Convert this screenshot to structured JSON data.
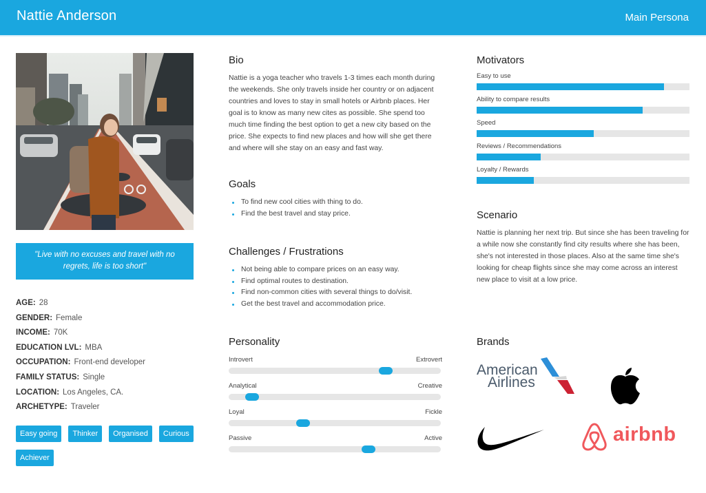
{
  "header": {
    "name": "Nattie Anderson",
    "persona_type": "Main Persona"
  },
  "profile": {
    "photo_alt": "Woman with backpack standing on a city bike lane",
    "quote": "\"Live with no excuses and travel with no regrets, life is too short\"",
    "facts": [
      {
        "key": "AGE:",
        "value": "28"
      },
      {
        "key": "GENDER:",
        "value": "Female"
      },
      {
        "key": "INCOME:",
        "value": "70K"
      },
      {
        "key": "EDUCATION LVL:",
        "value": "MBA"
      },
      {
        "key": "OCCUPATION:",
        "value": "Front-end developer"
      },
      {
        "key": "FAMILY STATUS:",
        "value": "Single"
      },
      {
        "key": "LOCATION:",
        "value": "Los Angeles, CA."
      },
      {
        "key": "ARCHETYPE:",
        "value": "Traveler"
      }
    ],
    "tags": [
      "Easy going",
      "Thinker",
      "Organised",
      "Curious",
      "Achiever"
    ]
  },
  "bio": {
    "title": "Bio",
    "text": "Nattie is a yoga teacher who travels 1-3 times each month during the weekends. She only travels inside her country or on adjacent countries and loves to stay in small hotels or Airbnb places. Her goal is to know as many new cites as possible. She spend too much time finding the best option to get a new city based on the price. She expects to find new places and how will she get there and where will she stay on an easy and fast way."
  },
  "goals": {
    "title": "Goals",
    "items": [
      "To find new cool cities with thing to do.",
      "Find the best travel and stay price."
    ]
  },
  "challenges": {
    "title": "Challenges / Frustrations",
    "items": [
      "Not being able to compare prices on an easy way.",
      "Find optimal routes to destination.",
      "Find non-common cities with several things to do/visit.",
      "Get the best travel and accommodation price."
    ]
  },
  "personality": {
    "title": "Personality",
    "traits": [
      {
        "left": "Introvert",
        "right": "Extrovert",
        "value": 0.74
      },
      {
        "left": "Analytical",
        "right": "Creative",
        "value": 0.11
      },
      {
        "left": "Loyal",
        "right": "Fickle",
        "value": 0.35
      },
      {
        "left": "Passive",
        "right": "Active",
        "value": 0.66
      }
    ]
  },
  "motivators": {
    "title": "Motivators",
    "items": [
      {
        "label": "Easy to use",
        "value": 0.88
      },
      {
        "label": "Ability to compare results",
        "value": 0.78
      },
      {
        "label": "Speed",
        "value": 0.55
      },
      {
        "label": "Reviews / Recommendations",
        "value": 0.3
      },
      {
        "label": "Loyalty / Rewards",
        "value": 0.27
      }
    ]
  },
  "scenario": {
    "title": "Scenario",
    "text": "Nattie is planning her next trip. But since she has been traveling for a while now she constantly find city results where she has been, she's not interested in those places. Also at the same time she's looking for cheap flights since she may come across an interest new place to visit at a low price."
  },
  "brands": {
    "title": "Brands",
    "items": [
      {
        "name": "American Airlines",
        "line1": "American",
        "line2": "Airlines",
        "icon": "american-airlines-logo"
      },
      {
        "name": "Apple",
        "icon": "apple-logo"
      },
      {
        "name": "Nike",
        "icon": "nike-swoosh-logo"
      },
      {
        "name": "Airbnb",
        "wordmark": "airbnb",
        "icon": "airbnb-logo"
      }
    ]
  },
  "colors": {
    "accent": "#1aa7df",
    "track": "#e6e6e6",
    "airbnb": "#f0585c",
    "aa_text": "#4a5a6b"
  }
}
